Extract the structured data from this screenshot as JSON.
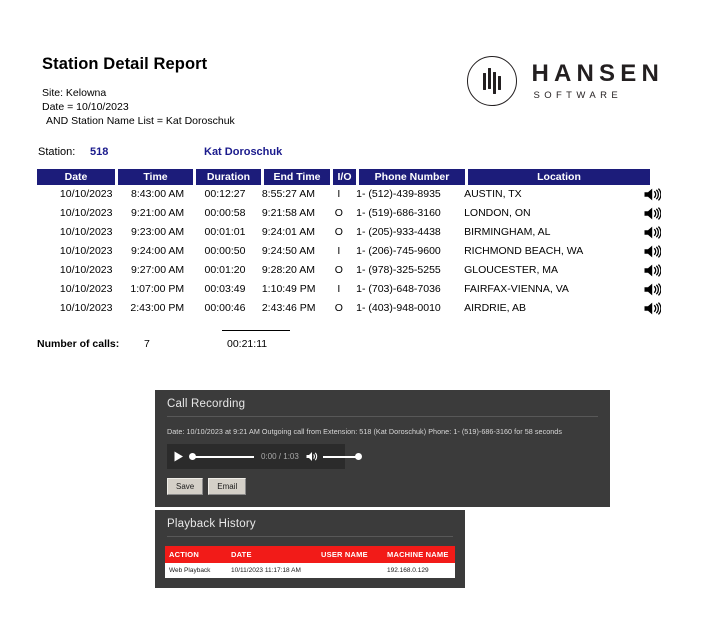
{
  "report": {
    "title": "Station Detail Report",
    "criteria": [
      "Site: Kelowna",
      "Date = 10/10/2023",
      " AND Station Name List = Kat Doroschuk"
    ]
  },
  "logo": {
    "name": "HANSEN",
    "subtitle": "SOFTWARE"
  },
  "station": {
    "label": "Station:",
    "number": "518",
    "name": "Kat Doroschuk"
  },
  "table": {
    "headers": {
      "date": "Date",
      "time": "Time",
      "duration": "Duration",
      "end_time": "End Time",
      "io": "I/O",
      "phone_number": "Phone Number",
      "location": "Location"
    },
    "rows": [
      {
        "date": "10/10/2023",
        "time": "8:43:00 AM",
        "duration": "00:12:27",
        "end_time": "8:55:27 AM",
        "io": "I",
        "phone": "1- (512)-439-8935",
        "location": "AUSTIN, TX",
        "play_icon": "speaker-icon"
      },
      {
        "date": "10/10/2023",
        "time": "9:21:00 AM",
        "duration": "00:00:58",
        "end_time": "9:21:58 AM",
        "io": "O",
        "phone": "1- (519)-686-3160",
        "location": "LONDON, ON",
        "play_icon": "speaker-icon"
      },
      {
        "date": "10/10/2023",
        "time": "9:23:00 AM",
        "duration": "00:01:01",
        "end_time": "9:24:01 AM",
        "io": "O",
        "phone": "1- (205)-933-4438",
        "location": "BIRMINGHAM, AL",
        "play_icon": "speaker-icon"
      },
      {
        "date": "10/10/2023",
        "time": "9:24:00 AM",
        "duration": "00:00:50",
        "end_time": "9:24:50 AM",
        "io": "I",
        "phone": "1- (206)-745-9600",
        "location": "RICHMOND BEACH, WA",
        "play_icon": "speaker-icon"
      },
      {
        "date": "10/10/2023",
        "time": "9:27:00 AM",
        "duration": "00:01:20",
        "end_time": "9:28:20 AM",
        "io": "O",
        "phone": "1- (978)-325-5255",
        "location": "GLOUCESTER, MA",
        "play_icon": "speaker-icon"
      },
      {
        "date": "10/10/2023",
        "time": "1:07:00 PM",
        "duration": "00:03:49",
        "end_time": "1:10:49 PM",
        "io": "I",
        "phone": "1- (703)-648-7036",
        "location": "FAIRFAX-VIENNA, VA",
        "play_icon": "speaker-icon"
      },
      {
        "date": "10/10/2023",
        "time": "2:43:00 PM",
        "duration": "00:00:46",
        "end_time": "2:43:46 PM",
        "io": "O",
        "phone": "1- (403)-948-0010",
        "location": "AIRDRIE, AB",
        "play_icon": "speaker-icon"
      }
    ]
  },
  "totals": {
    "calls_label": "Number of calls:",
    "calls_count": "7",
    "total_duration": "00:21:11"
  },
  "call_recording": {
    "title": "Call Recording",
    "description": "Date: 10/10/2023 at 9:21 AM Outgoing call from Extension: 518 (Kat Doroschuk) Phone: 1- (519)-686-3160 for 58 seconds",
    "player": {
      "play_icon": "play-icon",
      "volume_icon": "volume-icon",
      "time_display": "0:00 / 1:03",
      "current_time": "0:00",
      "duration": "1:03",
      "progress_percent": 0,
      "volume_percent": 100
    },
    "buttons": {
      "save": "Save",
      "email": "Email"
    }
  },
  "playback_history": {
    "title": "Playback History",
    "headers": [
      "ACTION",
      "DATE",
      "USER NAME",
      "MACHINE NAME"
    ],
    "rows": [
      {
        "action": "Web Playback",
        "date": "10/11/2023 11:17:18 AM",
        "user_name": "",
        "machine_name": "192.168.0.129"
      }
    ]
  },
  "colors": {
    "table_header": "#1c1c7a",
    "station_text": "#1a1a8c",
    "panel_bg": "#3b3b3b",
    "history_header": "#f21b18"
  }
}
